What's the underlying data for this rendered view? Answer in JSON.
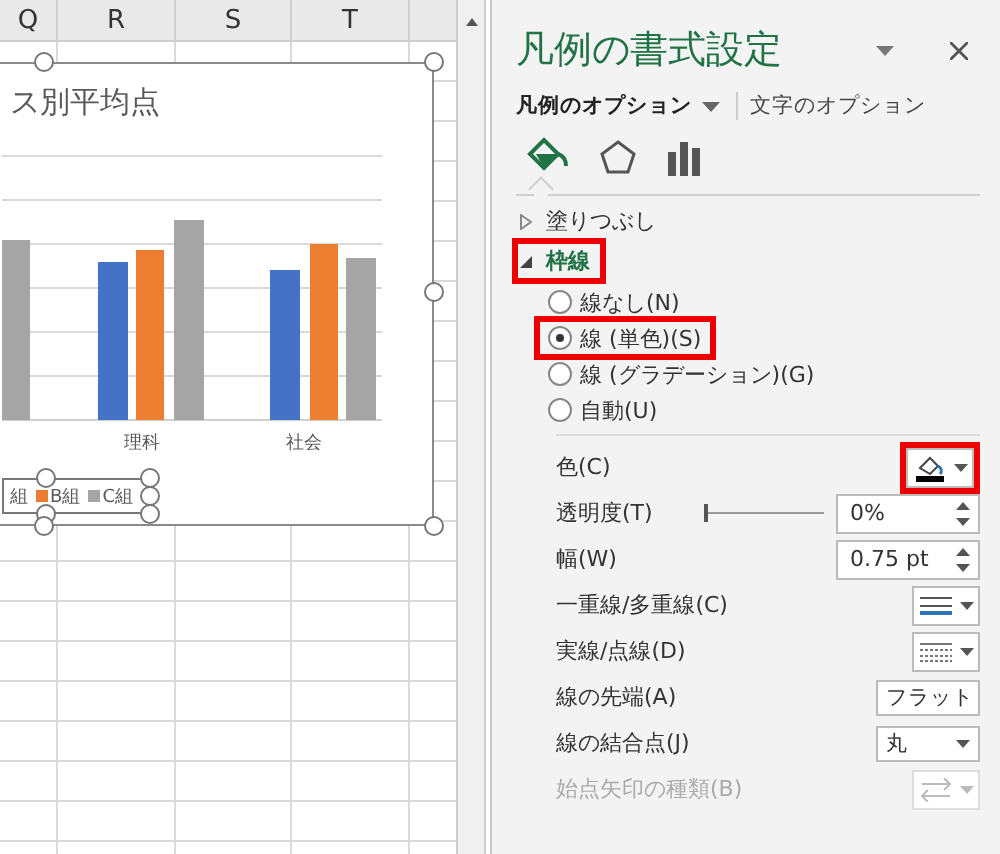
{
  "sheet": {
    "columns": [
      "Q",
      "R",
      "S",
      "T"
    ]
  },
  "chart": {
    "title": "ス別平均点",
    "categories": [
      "理科",
      "社会"
    ],
    "legend": [
      {
        "label": "組"
      },
      {
        "label": "B組",
        "color": "#ed7d31"
      },
      {
        "label": "C組",
        "color": "#a5a5a5"
      }
    ]
  },
  "pane": {
    "title": "凡例の書式設定",
    "tabs": [
      {
        "label": "凡例のオプション",
        "selected": true,
        "has_menu": true
      },
      {
        "label": "文字のオプション",
        "selected": false,
        "has_menu": false
      }
    ],
    "icon_tabs": [
      {
        "kind": "fill",
        "selected": true
      },
      {
        "kind": "effects",
        "selected": false
      },
      {
        "kind": "size",
        "selected": false
      }
    ],
    "sections": [
      {
        "label": "塗りつぶし",
        "expanded": false,
        "highlighted": false
      },
      {
        "label": "枠線",
        "expanded": true,
        "highlighted": true
      }
    ],
    "line_types": [
      {
        "label": "線なし(N)",
        "selected": false,
        "highlighted": false
      },
      {
        "label": "線 (単色)(S)",
        "selected": true,
        "highlighted": true
      },
      {
        "label": "線 (グラデーション)(G)",
        "selected": false,
        "highlighted": false
      },
      {
        "label": "自動(U)",
        "selected": false,
        "highlighted": false
      }
    ],
    "properties": [
      {
        "kind": "color",
        "label": "色(C)",
        "highlighted": true,
        "disabled": false
      },
      {
        "kind": "slider",
        "label": "透明度(T)",
        "level": 0,
        "value": "0%",
        "disabled": false
      },
      {
        "kind": "spin",
        "label": "幅(W)",
        "value": "0.75 pt",
        "disabled": false
      },
      {
        "kind": "compound",
        "label": "一重線/多重線(C)",
        "disabled": false
      },
      {
        "kind": "dash",
        "label": "実線/点線(D)",
        "disabled": false
      },
      {
        "kind": "select",
        "label": "線の先端(A)",
        "value": "フラット",
        "disabled": false
      },
      {
        "kind": "select",
        "label": "線の結合点(J)",
        "value": "丸",
        "disabled": false
      },
      {
        "kind": "arrow",
        "label": "始点矢印の種類(B)",
        "disabled": true
      }
    ]
  }
}
